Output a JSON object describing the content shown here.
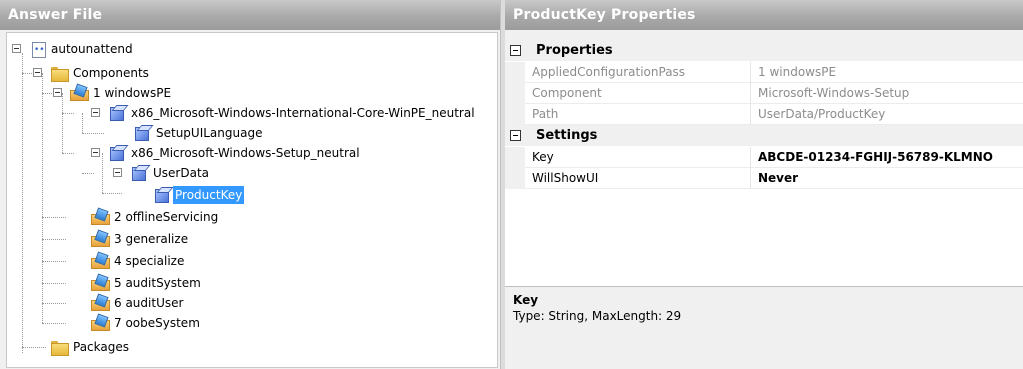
{
  "answer_file_pane": {
    "title": "Answer File",
    "tree": [
      {
        "label": "autounattend",
        "icon": "answer-file-icon"
      },
      {
        "label": "Components",
        "icon": "folder-icon"
      },
      {
        "label": "1 windowsPE",
        "icon": "config-pass-icon"
      },
      {
        "label": "x86_Microsoft-Windows-International-Core-WinPE_neutral",
        "icon": "component-icon"
      },
      {
        "label": "SetupUILanguage",
        "icon": "component-icon"
      },
      {
        "label": "x86_Microsoft-Windows-Setup_neutral",
        "icon": "component-icon"
      },
      {
        "label": "UserData",
        "icon": "component-icon"
      },
      {
        "label": "ProductKey",
        "icon": "component-icon",
        "selected": true
      },
      {
        "label": "2 offlineServicing",
        "icon": "config-pass-icon"
      },
      {
        "label": "3 generalize",
        "icon": "config-pass-icon"
      },
      {
        "label": "4 specialize",
        "icon": "config-pass-icon"
      },
      {
        "label": "5 auditSystem",
        "icon": "config-pass-icon"
      },
      {
        "label": "6 auditUser",
        "icon": "config-pass-icon"
      },
      {
        "label": "7 oobeSystem",
        "icon": "config-pass-icon"
      },
      {
        "label": "Packages",
        "icon": "folder-icon"
      }
    ]
  },
  "properties_pane": {
    "title": "ProductKey Properties",
    "categories": [
      {
        "label": "Properties",
        "rows": [
          {
            "name": "AppliedConfigurationPass",
            "value": "1 windowsPE"
          },
          {
            "name": "Component",
            "value": "Microsoft-Windows-Setup"
          },
          {
            "name": "Path",
            "value": "UserData/ProductKey"
          }
        ]
      },
      {
        "label": "Settings",
        "rows": [
          {
            "name": "Key",
            "value": "ABCDE-01234-FGHIJ-56789-KLMNO"
          },
          {
            "name": "WillShowUI",
            "value": "Never"
          }
        ]
      }
    ],
    "description": {
      "title": "Key",
      "text": "Type: String, MaxLength: 29"
    }
  }
}
